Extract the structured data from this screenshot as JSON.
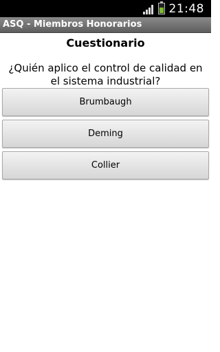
{
  "status_bar": {
    "time": "21:48",
    "icons": [
      "signal-icon",
      "battery-icon"
    ],
    "battery_color": "#7dbb2c"
  },
  "app_bar": {
    "title": "ASQ - Miembros Honorarios"
  },
  "quiz": {
    "heading": "Cuestionario",
    "question": "¿Quién aplico el control de calidad en el sistema industrial?",
    "answers": [
      {
        "label": "Brumbaugh"
      },
      {
        "label": "Deming"
      },
      {
        "label": "Collier"
      }
    ]
  }
}
